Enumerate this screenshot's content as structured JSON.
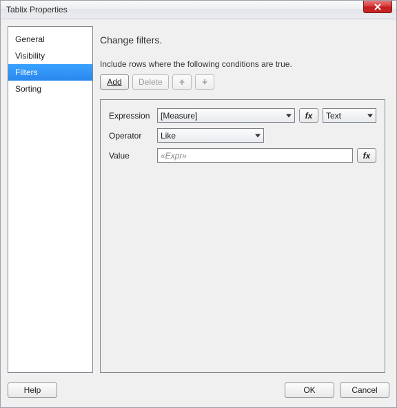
{
  "window": {
    "title": "Tablix Properties"
  },
  "sidebar": {
    "items": [
      {
        "label": "General"
      },
      {
        "label": "Visibility"
      },
      {
        "label": "Filters"
      },
      {
        "label": "Sorting"
      }
    ],
    "selected_index": 2
  },
  "content": {
    "heading": "Change filters.",
    "description": "Include rows where the following conditions are true.",
    "toolbar": {
      "add_label": "Add",
      "delete_label": "Delete"
    },
    "form": {
      "expression_label": "Expression",
      "expression_value": "[Measure]",
      "type_value": "Text",
      "operator_label": "Operator",
      "operator_value": "Like",
      "value_label": "Value",
      "value_placeholder": "«Expr»",
      "fx_label": "fx"
    }
  },
  "footer": {
    "help_label": "Help",
    "ok_label": "OK",
    "cancel_label": "Cancel"
  }
}
